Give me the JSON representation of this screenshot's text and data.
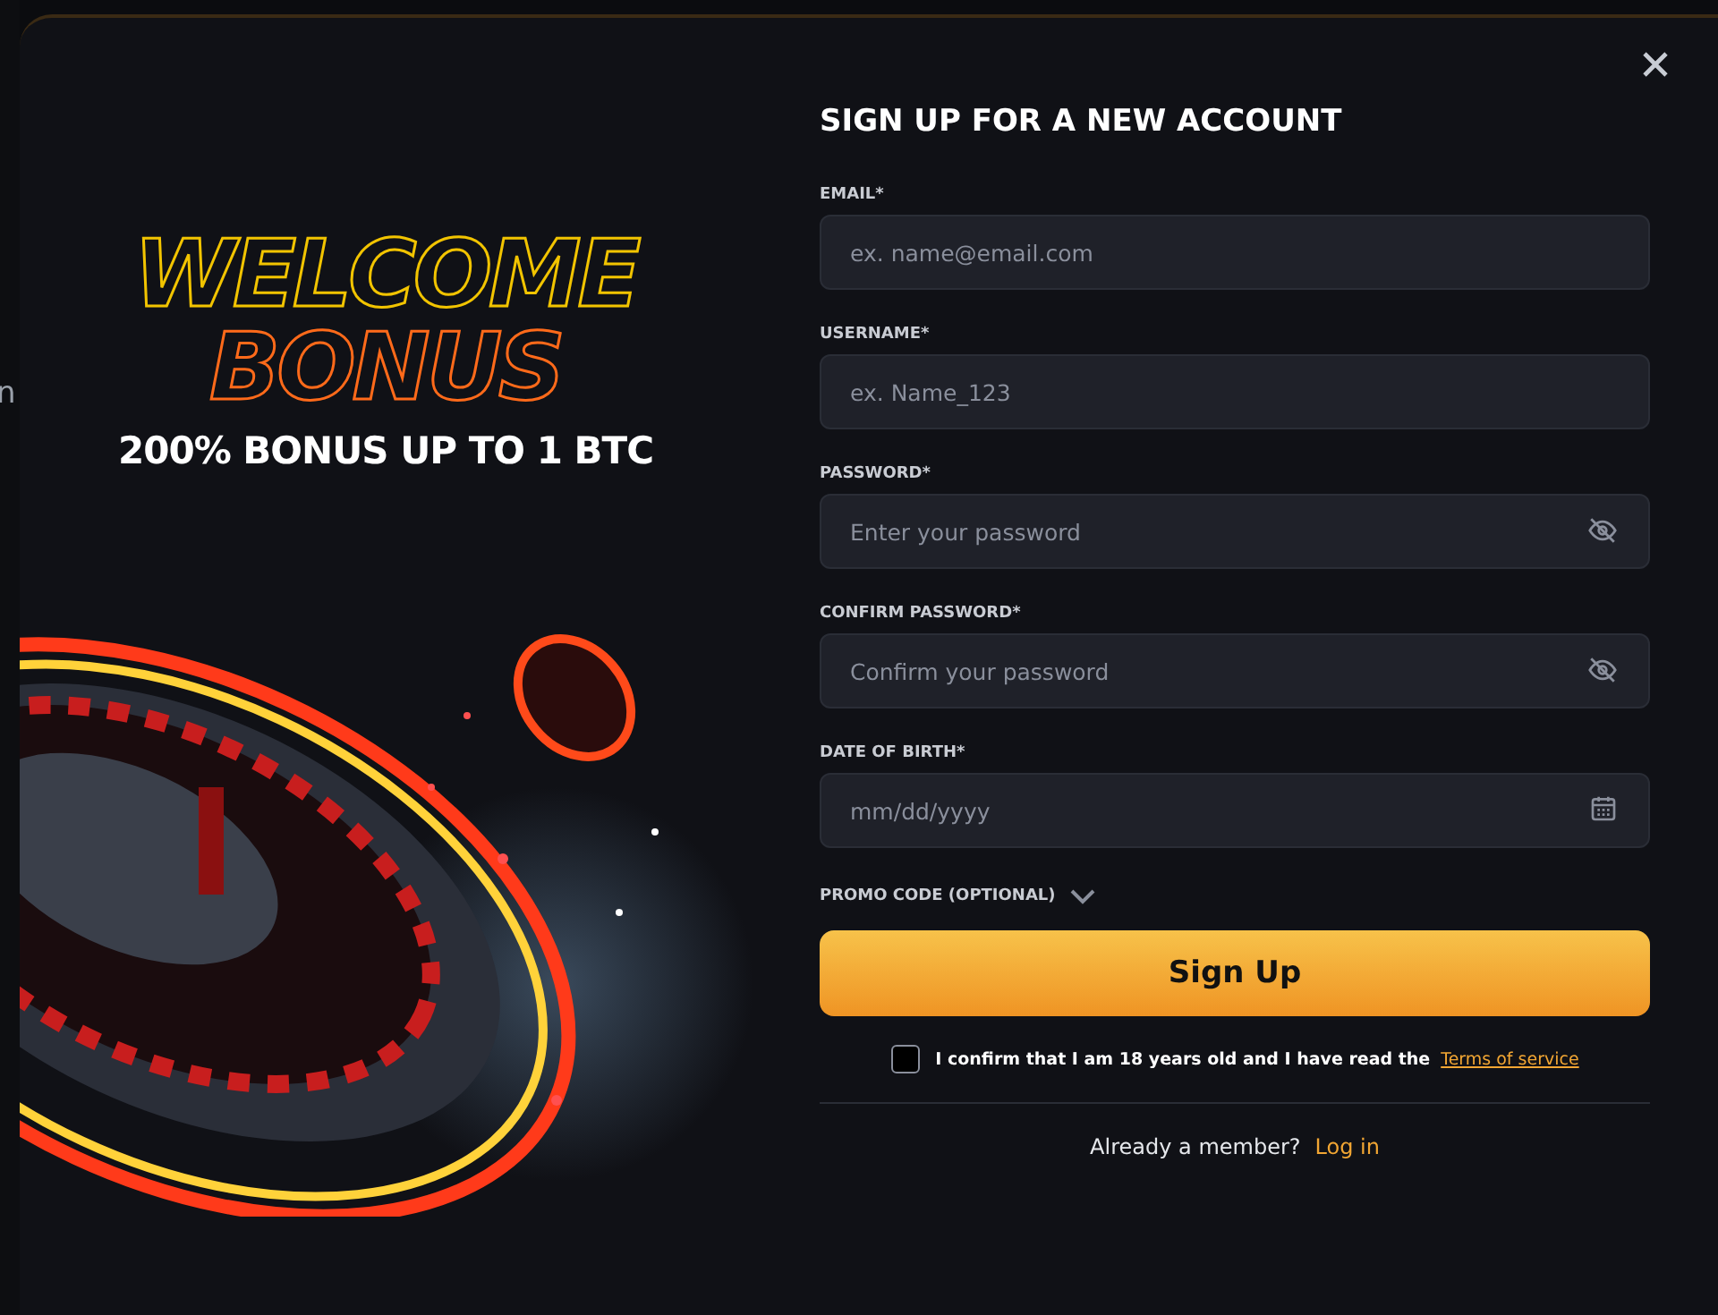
{
  "background_page": {
    "fragment": "n"
  },
  "promo": {
    "headline_top": "WELCOME",
    "headline_bottom": "BONUS",
    "offer": "200% BONUS UP TO 1 BTC"
  },
  "form": {
    "title": "SIGN UP FOR A NEW ACCOUNT",
    "fields": [
      {
        "label": "EMAIL*",
        "placeholder": "ex. name@email.com",
        "kind": "text"
      },
      {
        "label": "USERNAME*",
        "placeholder": "ex. Name_123",
        "kind": "text"
      },
      {
        "label": "PASSWORD*",
        "placeholder": "Enter your password",
        "kind": "password"
      },
      {
        "label": "CONFIRM PASSWORD*",
        "placeholder": "Confirm your password",
        "kind": "password"
      },
      {
        "label": "DATE OF BIRTH*",
        "placeholder": "mm/dd/yyyy",
        "kind": "date"
      }
    ],
    "promo_code": {
      "label": "PROMO CODE (OPTIONAL)",
      "expanded": false
    },
    "submit": "Sign Up",
    "consent": {
      "text": "I confirm that I am 18 years old and I have read the",
      "link": "Terms of service",
      "checked": false
    },
    "login_prompt": "Already a member?",
    "login_link": "Log in"
  }
}
